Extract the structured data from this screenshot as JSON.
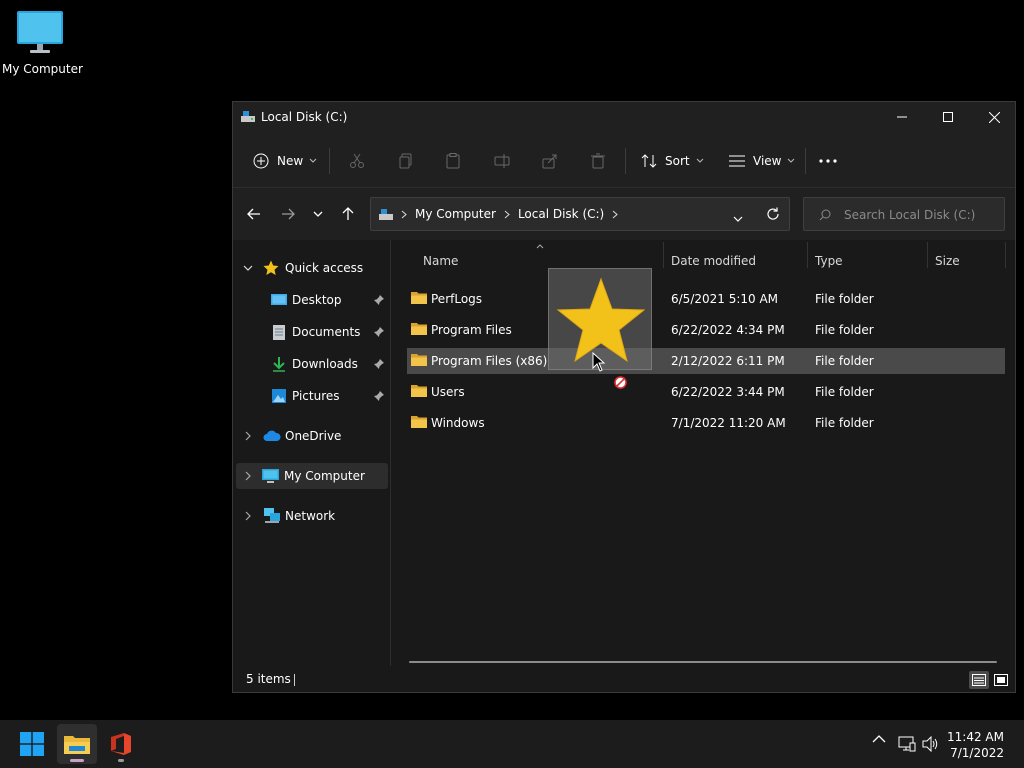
{
  "desktop": {
    "icon_label": "My Computer"
  },
  "window": {
    "title": "Local Disk (C:)",
    "commands": {
      "new_label": "New",
      "sort_label": "Sort",
      "view_label": "View"
    },
    "address": {
      "crumbs": [
        "My Computer",
        "Local Disk (C:)"
      ]
    },
    "search": {
      "placeholder": "Search Local Disk (C:)"
    },
    "nav": {
      "quick_access": "Quick access",
      "desktop": "Desktop",
      "documents": "Documents",
      "downloads": "Downloads",
      "pictures": "Pictures",
      "onedrive": "OneDrive",
      "my_computer": "My Computer",
      "network": "Network"
    },
    "columns": {
      "name": "Name",
      "date": "Date modified",
      "type": "Type",
      "size": "Size"
    },
    "files": [
      {
        "name": "PerfLogs",
        "date": "6/5/2021 5:10 AM",
        "type": "File folder"
      },
      {
        "name": "Program Files",
        "date": "6/22/2022 4:34 PM",
        "type": "File folder"
      },
      {
        "name": "Program Files (x86)",
        "date": "2/12/2022 6:11 PM",
        "type": "File folder"
      },
      {
        "name": "Users",
        "date": "6/22/2022 3:44 PM",
        "type": "File folder"
      },
      {
        "name": "Windows",
        "date": "7/1/2022 11:20 AM",
        "type": "File folder"
      }
    ],
    "highlighted_row": "Program Files (x86)",
    "status": {
      "count": "5 items"
    }
  },
  "drag": {
    "ghost_icon": "star-icon",
    "cursor_state": "no-drop"
  },
  "taskbar": {
    "time": "11:42 AM",
    "date": "7/1/2022"
  },
  "colors": {
    "folder": "#e8b93c",
    "star": "#f2c21b",
    "accent": "#0a84d8"
  }
}
